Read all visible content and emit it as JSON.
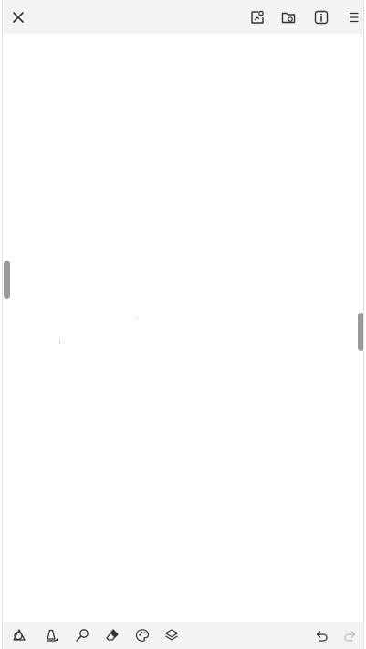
{
  "toolbar_top": {
    "close_icon": "close-icon",
    "icons": [
      "insert-image-icon",
      "folder-icon",
      "info-icon",
      "menu-icon"
    ]
  },
  "toolbar_bottom": {
    "tools": [
      "shapes-icon",
      "pen-icon",
      "pencil-icon",
      "eraser-icon",
      "palette-icon",
      "layers-icon"
    ],
    "actions": [
      "undo-icon",
      "redo-icon"
    ],
    "colors": {
      "icon": "#333333",
      "disabled": "#bdbdbd",
      "bar": "#f3f3f3",
      "handle": "#9a9a9a"
    }
  }
}
